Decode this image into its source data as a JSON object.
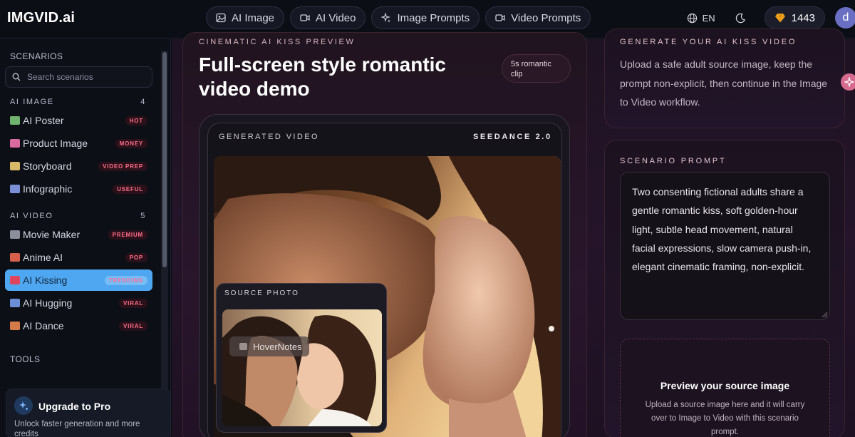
{
  "brand": {
    "logo": "IMGVID.ai"
  },
  "nav": {
    "items": [
      {
        "label": "AI Image",
        "icon": "image-icon"
      },
      {
        "label": "AI Video",
        "icon": "video-icon"
      },
      {
        "label": "Image Prompts",
        "icon": "sparkles-icon"
      },
      {
        "label": "Video Prompts",
        "icon": "video-icon"
      }
    ]
  },
  "header": {
    "language": "EN",
    "credits": "1443",
    "avatar_letter": "d"
  },
  "sidebar": {
    "scenarios_heading": "SCENARIOS",
    "search_placeholder": "Search scenarios",
    "groups": [
      {
        "title": "AI IMAGE",
        "count": "4"
      },
      {
        "title": "AI VIDEO",
        "count": "5"
      }
    ],
    "image_items": [
      {
        "label": "AI Poster",
        "badge": "HOT",
        "emoji_color": "#6fb36f"
      },
      {
        "label": "Product Image",
        "badge": "MONEY",
        "emoji_color": "#d86aa0"
      },
      {
        "label": "Storyboard",
        "badge": "VIDEO PREP",
        "emoji_color": "#d8b96a"
      },
      {
        "label": "Infographic",
        "badge": "USEFUL",
        "emoji_color": "#7a8fd6"
      }
    ],
    "video_items": [
      {
        "label": "Movie Maker",
        "badge": "PREMIUM",
        "emoji_color": "#8b8f9c"
      },
      {
        "label": "Anime AI",
        "badge": "POP",
        "emoji_color": "#d6604a"
      },
      {
        "label": "AI Kissing",
        "badge": "TRENDING",
        "emoji_color": "#e0455f",
        "active": true
      },
      {
        "label": "AI Hugging",
        "badge": "VIRAL",
        "emoji_color": "#6a8fd6"
      },
      {
        "label": "AI Dance",
        "badge": "VIRAL",
        "emoji_color": "#d67a4a"
      }
    ],
    "tools_heading": "TOOLS",
    "upgrade": {
      "title": "Upgrade to Pro",
      "subtitle": "Unlock faster generation and more credits"
    }
  },
  "preview": {
    "eyebrow": "CINEMATIC AI KISS PREVIEW",
    "title": "Full-screen style romantic video demo",
    "pill": "5s romantic clip",
    "generated_label": "GENERATED VIDEO",
    "model_label": "SEEDANCE 2.0",
    "source_label": "SOURCE PHOTO",
    "hover_notes": "HoverNotes"
  },
  "generate": {
    "eyebrow": "GENERATE YOUR AI KISS VIDEO",
    "text": "Upload a safe adult source image, keep the prompt non-explicit, then continue in the Image to Video workflow."
  },
  "scenario_prompt": {
    "eyebrow": "SCENARIO PROMPT",
    "value": "Two consenting fictional adults share a gentle romantic kiss, soft golden-hour light, subtle head movement, natural facial expressions, slow camera push-in, elegant cinematic framing, non-explicit."
  },
  "dropzone": {
    "title": "Preview your source image",
    "subtitle": "Upload a source image here and it will carry over to Image to Video with this scenario prompt."
  },
  "colors": {
    "accent": "#4ea7f0",
    "badge_text": "#ff6d8a",
    "background": "#0b0d14"
  }
}
